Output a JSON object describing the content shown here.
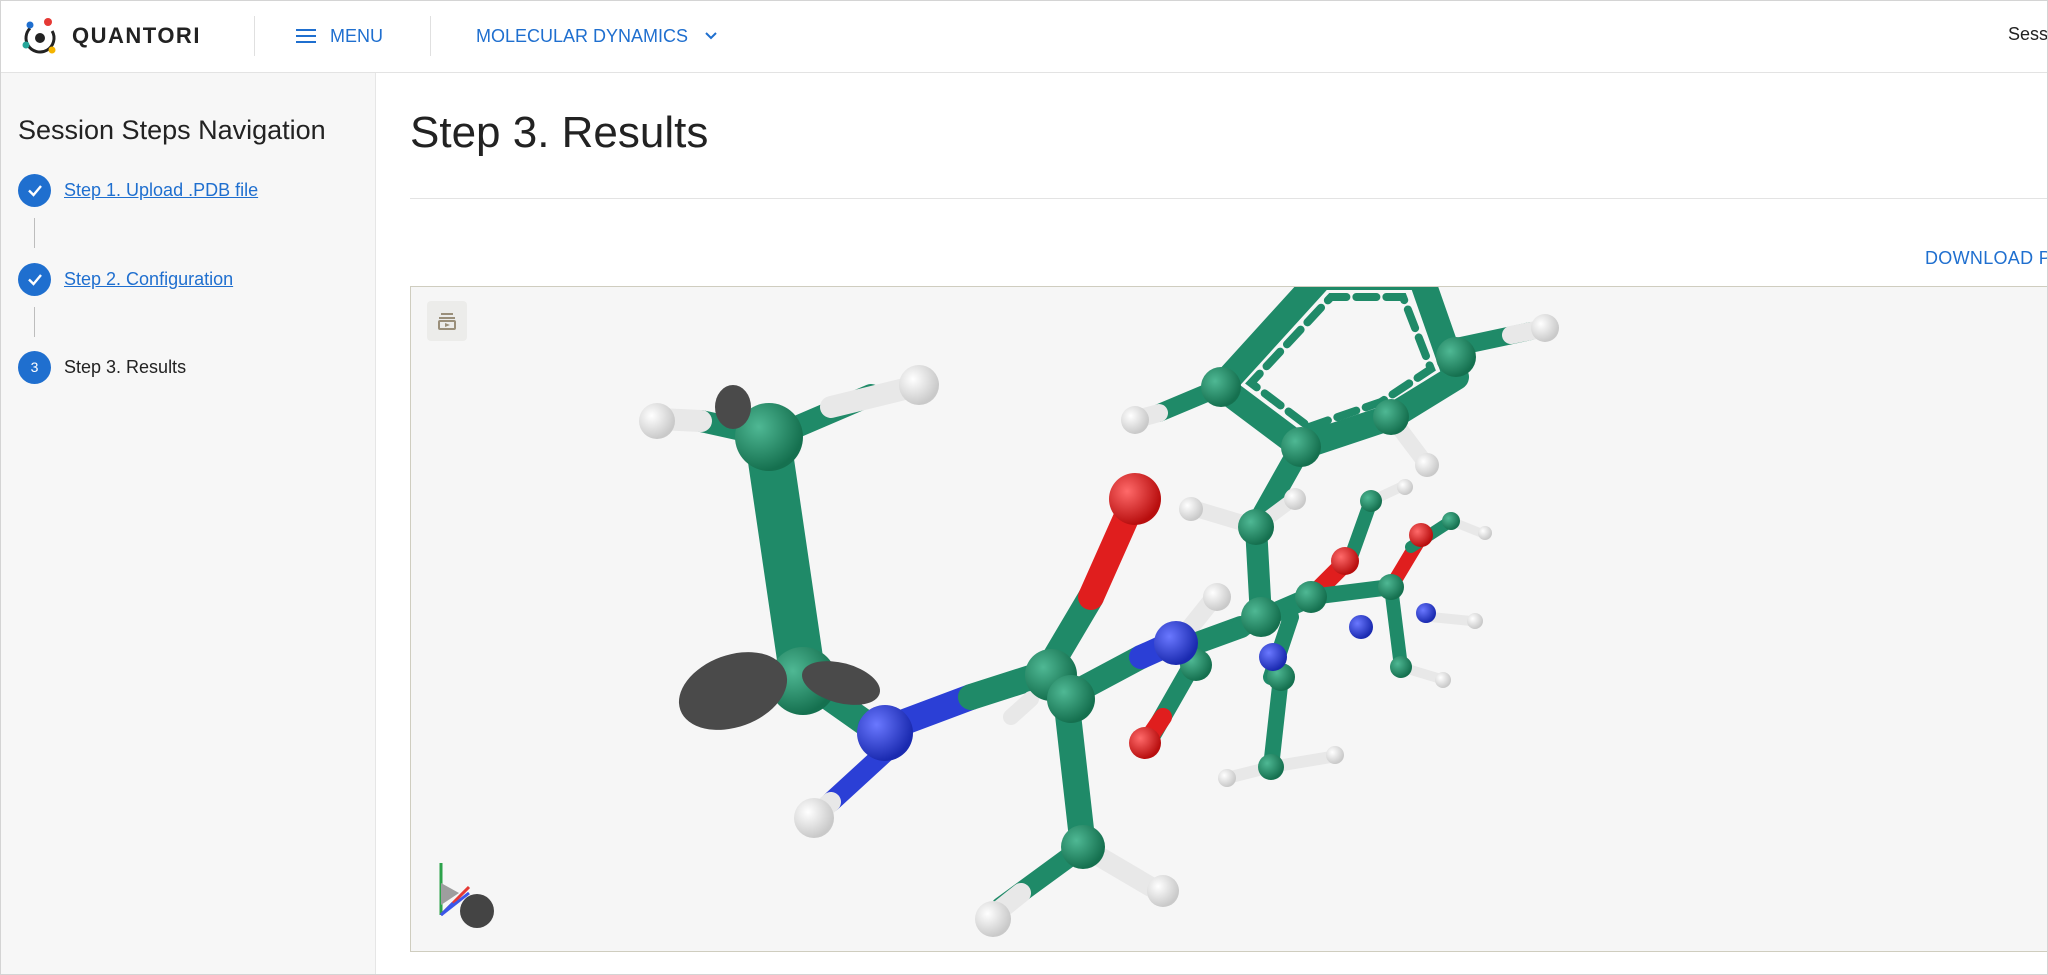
{
  "header": {
    "brand": "QUANTORI",
    "menu_label": "MENU",
    "module_label": "MOLECULAR DYNAMICS",
    "session_label": "Sess"
  },
  "sidebar": {
    "title": "Session Steps Navigation",
    "steps": [
      {
        "label": "Step 1. Upload .PDB file",
        "state": "completed"
      },
      {
        "label": "Step 2. Configuration",
        "state": "completed"
      },
      {
        "label": "Step 3. Results",
        "state": "active",
        "number": "3"
      }
    ]
  },
  "main": {
    "title": "Step 3. Results",
    "download_label": "DOWNLOAD P"
  },
  "viewer": {
    "icons": [
      "viewer-controls-toggle-icon",
      "orientation-axes-icon"
    ]
  },
  "colors": {
    "accent": "#1f6fcf",
    "carbon": "#1f8a68",
    "nitrogen": "#2b3fd6",
    "oxygen": "#e01e1e",
    "hydrogen": "#f2f2f2",
    "sulfur_marker": "#4a4a4a"
  }
}
